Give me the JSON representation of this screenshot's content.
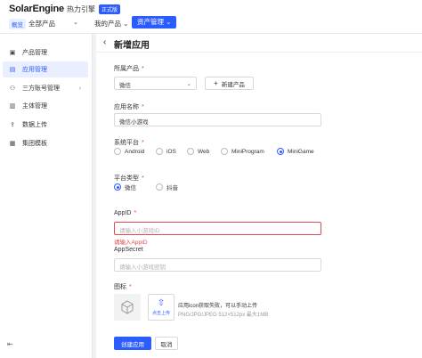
{
  "header": {
    "logo_text": "SolarEngine",
    "logo_cn": "热力引擎",
    "env_badge": "正式版",
    "version_badge": "概览",
    "org_select": "全部产品",
    "nav": [
      {
        "label": "我的产品 ⌄"
      },
      {
        "label": "资产管理 ⌄"
      }
    ]
  },
  "sidebar": {
    "items": [
      {
        "label": "产品管理",
        "icon": "box-icon"
      },
      {
        "label": "应用管理",
        "icon": "app-icon"
      },
      {
        "label": "三方账号管理",
        "icon": "account-icon"
      },
      {
        "label": "主体管理",
        "icon": "entity-icon"
      },
      {
        "label": "数据上传",
        "icon": "upload-icon"
      },
      {
        "label": "集团模板",
        "icon": "template-icon"
      }
    ],
    "collapse": "⇤"
  },
  "form": {
    "title": "新增应用",
    "product": {
      "label": "所属产品",
      "value": "微信",
      "new_btn": "新建产品"
    },
    "app_name": {
      "label": "应用名称",
      "value": "微信小游戏"
    },
    "platform": {
      "label": "系统平台",
      "options": [
        "Android",
        "iOS",
        "Web",
        "MiniProgram",
        "MiniGame"
      ],
      "selected": "MiniGame"
    },
    "platform_type": {
      "label": "平台类型",
      "options": [
        "微信",
        "抖音"
      ],
      "selected": "微信"
    },
    "appid": {
      "label": "AppID",
      "placeholder": "请输入小游戏ID",
      "error": "请输入AppID"
    },
    "appsecret": {
      "label": "AppSecret",
      "placeholder": "请输入小游戏密钥"
    },
    "icon": {
      "label": "图标",
      "upload_label": "点击上传",
      "hint": "应用icon获取失败，可以手动上传",
      "spec": "PNG/JPG/JPEG 512×512px 最大1MB"
    },
    "submit": "创建应用",
    "cancel": "取消"
  },
  "colors": {
    "accent": "#2b5cff",
    "error": "#e5484d"
  }
}
